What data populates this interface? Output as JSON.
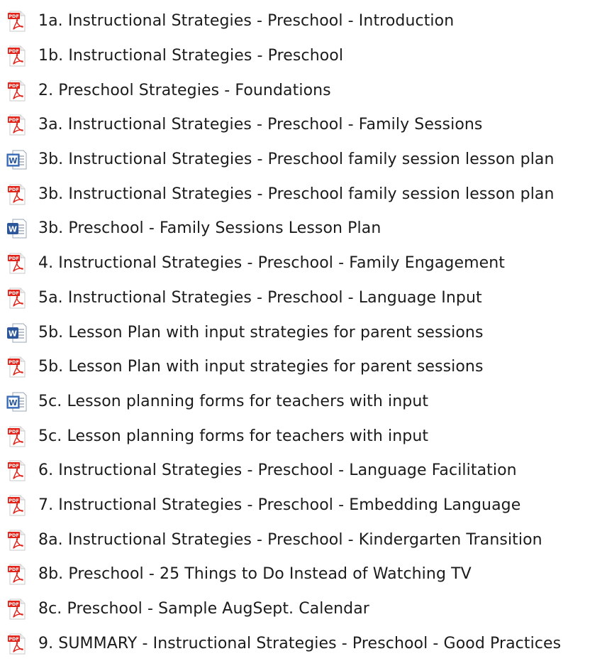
{
  "colors": {
    "pdf_red": "#e2231a",
    "pdf_light": "#f6d5d2",
    "word_blue": "#2b579a",
    "word_blue_light": "#4a7fd0",
    "text": "#1b1b1b"
  },
  "files": [
    {
      "name": "1a. Instructional Strategies - Preschool - Introduction",
      "icon": "pdf-icon"
    },
    {
      "name": "1b. Instructional Strategies - Preschool",
      "icon": "pdf-icon"
    },
    {
      "name": "2. Preschool Strategies - Foundations",
      "icon": "pdf-icon"
    },
    {
      "name": "3a. Instructional Strategies - Preschool - Family Sessions",
      "icon": "pdf-icon"
    },
    {
      "name": "3b. Instructional Strategies - Preschool  family session lesson plan",
      "icon": "word-doc-old-icon"
    },
    {
      "name": "3b. Instructional Strategies - Preschool  family session lesson plan",
      "icon": "pdf-icon"
    },
    {
      "name": "3b. Preschool - Family Sessions Lesson Plan",
      "icon": "word-doc-icon"
    },
    {
      "name": "4. Instructional Strategies - Preschool - Family Engagement",
      "icon": "pdf-icon"
    },
    {
      "name": "5a. Instructional Strategies - Preschool - Language Input",
      "icon": "pdf-icon"
    },
    {
      "name": "5b. Lesson Plan with input strategies for parent sessions",
      "icon": "word-doc-icon"
    },
    {
      "name": "5b. Lesson Plan with input strategies for parent sessions",
      "icon": "pdf-icon"
    },
    {
      "name": "5c. Lesson planning forms for teachers with input",
      "icon": "word-doc-old-icon"
    },
    {
      "name": "5c. Lesson planning forms for teachers with input",
      "icon": "pdf-icon"
    },
    {
      "name": "6. Instructional Strategies - Preschool - Language Facilitation",
      "icon": "pdf-icon"
    },
    {
      "name": "7. Instructional Strategies - Preschool - Embedding Language",
      "icon": "pdf-icon"
    },
    {
      "name": "8a. Instructional Strategies - Preschool - Kindergarten Transition",
      "icon": "pdf-icon"
    },
    {
      "name": "8b. Preschool - 25 Things to Do Instead of Watching TV",
      "icon": "pdf-icon"
    },
    {
      "name": "8c. Preschool - Sample AugSept. Calendar",
      "icon": "pdf-icon"
    },
    {
      "name": "9. SUMMARY - Instructional Strategies - Preschool - Good Practices",
      "icon": "pdf-icon"
    }
  ]
}
